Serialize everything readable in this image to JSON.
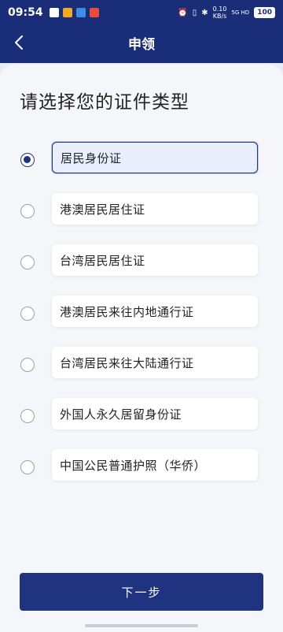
{
  "status": {
    "time": "09:54",
    "net_speed": "0.10",
    "net_unit": "KB/s",
    "signal": "5G HD",
    "battery": "100"
  },
  "header": {
    "title": "申领"
  },
  "heading": "请选择您的证件类型",
  "options": [
    {
      "label": "居民身份证",
      "selected": true
    },
    {
      "label": "港澳居民居住证",
      "selected": false
    },
    {
      "label": "台湾居民居住证",
      "selected": false
    },
    {
      "label": "港澳居民来往内地通行证",
      "selected": false
    },
    {
      "label": "台湾居民来往大陆通行证",
      "selected": false
    },
    {
      "label": "外国人永久居留身份证",
      "selected": false
    },
    {
      "label": "中国公民普通护照（华侨）",
      "selected": false
    }
  ],
  "next_button": "下一步",
  "colors": {
    "brand": "#1f3380",
    "header_bg": "#1a2d78"
  }
}
